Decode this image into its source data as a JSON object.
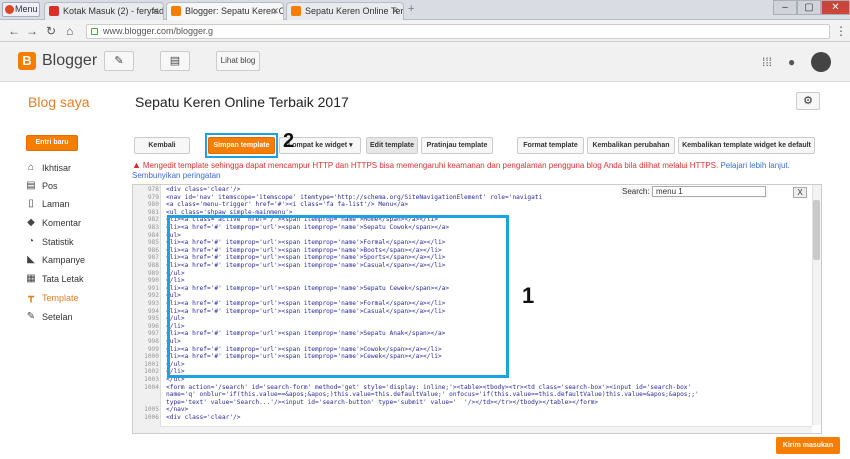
{
  "browser": {
    "menu_label": "Menu",
    "tabs": [
      {
        "label": "Kotak Masuk (2) - feryfadil",
        "fav_color": "#d93025"
      },
      {
        "label": "Blogger: Sepatu Keren Onl",
        "fav_color": "#f57d00"
      },
      {
        "label": "Sepatu Keren Online Terba",
        "fav_color": "#f57d00"
      }
    ],
    "url": "www.blogger.com/blogger.g"
  },
  "header": {
    "logo_letter": "B",
    "app_name": "Blogger",
    "view_blog": "Lihat blog"
  },
  "page": {
    "section": "Blog saya",
    "blog_title": "Sepatu Keren Online Terbaik 2017"
  },
  "sidebar": {
    "new_post": "Entri baru",
    "items": [
      {
        "label": "Ikhtisar",
        "icon": "home-icon",
        "glyph": "⌂"
      },
      {
        "label": "Pos",
        "icon": "posts-icon",
        "glyph": "▤"
      },
      {
        "label": "Laman",
        "icon": "pages-icon",
        "glyph": "▯"
      },
      {
        "label": "Komentar",
        "icon": "comments-icon",
        "glyph": "◆"
      },
      {
        "label": "Statistik",
        "icon": "stats-icon",
        "glyph": "◔"
      },
      {
        "label": "Kampanye",
        "icon": "campaign-icon",
        "glyph": "◣"
      },
      {
        "label": "Tata Letak",
        "icon": "layout-icon",
        "glyph": "▦"
      },
      {
        "label": "Template",
        "icon": "template-icon",
        "glyph": "┳"
      },
      {
        "label": "Setelan",
        "icon": "wrench-icon",
        "glyph": "✎"
      }
    ]
  },
  "toolbar": {
    "back": "Kembali",
    "save": "Simpan template",
    "jump": "Lompat ke widget",
    "edit": "Edit template",
    "preview": "Pratinjau template",
    "format": "Format template",
    "revert": "Kembalikan perubahan",
    "revert_widget": "Kembalikan template widget ke default"
  },
  "warning": {
    "text": "Mengedit template sehingga dapat mencampur HTTP dan HTTPS bisa memengaruhi keamanan dan pengalaman pengguna blog Anda bila dilihat melalui HTTPS.",
    "link": "Pelajari lebih lanjut.",
    "hide": "Sembunyikan peringatan"
  },
  "annotations": {
    "one": "1",
    "two": "2"
  },
  "search": {
    "label": "Search:",
    "value": "menu 1",
    "close": "X"
  },
  "editor": {
    "line_numbers": [
      "978",
      "979",
      "980",
      "981",
      "982",
      "983",
      "984",
      "985",
      "986",
      "987",
      "988",
      "989",
      "990",
      "991",
      "992",
      "993",
      "994",
      "995",
      "996",
      "997",
      "998",
      "999",
      "1000",
      "1001",
      "1002",
      "1003",
      "1004",
      "",
      "",
      "1005",
      "1006"
    ],
    "lines": [
      "<div class='clear'/>",
      "<nav id='nav' itemscope='itemscope' itemtype='http://schema.org/SiteNavigationElement' role='navigati",
      "<a class='menu-trigger' href='#'><i class='fa fa-list'/> Menu</a>",
      "<ul class='shpaw simple-mainmenu'>",
      "<li><a class='active' href='/'><span itemprop='name'>Home</span></a></li>",
      "<li><a href='#' itemprop='url'><span itemprop='name'>Sepatu Cowok</span></a>",
      "<ul>",
      "<li><a href='#' itemprop='url'><span itemprop='name'>Formal</span></a></li>",
      "<li><a href='#' itemprop='url'><span itemprop='name'>Boots</span></a></li>",
      "<li><a href='#' itemprop='url'><span itemprop='name'>Sports</span></a></li>",
      "<li><a href='#' itemprop='url'><span itemprop='name'>Casual</span></a></li>",
      "</ul>",
      "</li>",
      "<li><a href='#' itemprop='url'><span itemprop='name'>Sepatu Cewek</span></a>",
      "<ul>",
      "<li><a href='#' itemprop='url'><span itemprop='name'>Formal</span></a></li>",
      "<li><a href='#' itemprop='url'><span itemprop='name'>Casual</span></a></li>",
      "</ul>",
      "</li>",
      "<li><a href='#' itemprop='url'><span itemprop='name'>Sepatu Anak</span></a>",
      "<ul>",
      "<li><a href='#' itemprop='url'><span itemprop='name'>Cowok</span></a></li>",
      "<li><a href='#' itemprop='url'><span itemprop='name'>Cewek</span></a></li>",
      "</ul>",
      "</li>",
      "</ul>",
      "<form action='/search' id='search-form' method='get' style='display: inline;'><table><tbody><tr><td class='search-box'><input id='search-box'",
      "name='q' onblur='if(this.value==&apos;&apos;)this.value=this.defaultValue;' onfocus='if(this.value==this.defaultValue)this.value=&apos;&apos;;'",
      "type='text' value='Search...'/><input id='search-button' type='submit' value='  '/></td></tr></tbody></table></form>",
      "</nav>",
      "<div class='clear'/>"
    ]
  },
  "feedback": "Kirim masukan",
  "colors": {
    "accent": "#f57d00",
    "highlight": "#1ea1e0",
    "warning": "#dd3333"
  }
}
